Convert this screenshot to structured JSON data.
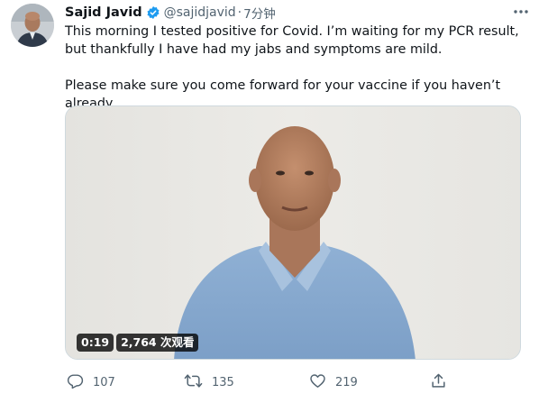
{
  "tweet": {
    "author_name": "Sajid Javid",
    "handle": "@sajidjavid",
    "separator": "·",
    "time": "7分钟",
    "paragraphs": [
      "This morning I tested positive for Covid. I’m waiting for my PCR result, but thankfully I have had my jabs and symptoms are mild.",
      "Please make sure you come forward for your vaccine if you haven’t already."
    ]
  },
  "video": {
    "duration": "0:19",
    "views": "2,764 次观看"
  },
  "actions": {
    "reply_count": "107",
    "retweet_count": "135",
    "like_count": "219"
  },
  "icons": {
    "verified": "verified-badge-icon",
    "more": "more-options-icon",
    "reply": "reply-icon",
    "retweet": "retweet-icon",
    "like": "like-icon",
    "share": "share-icon"
  },
  "colors": {
    "text": "#0f1419",
    "secondary": "#536471",
    "verified": "#1d9bf0",
    "border": "#cfd9de"
  }
}
